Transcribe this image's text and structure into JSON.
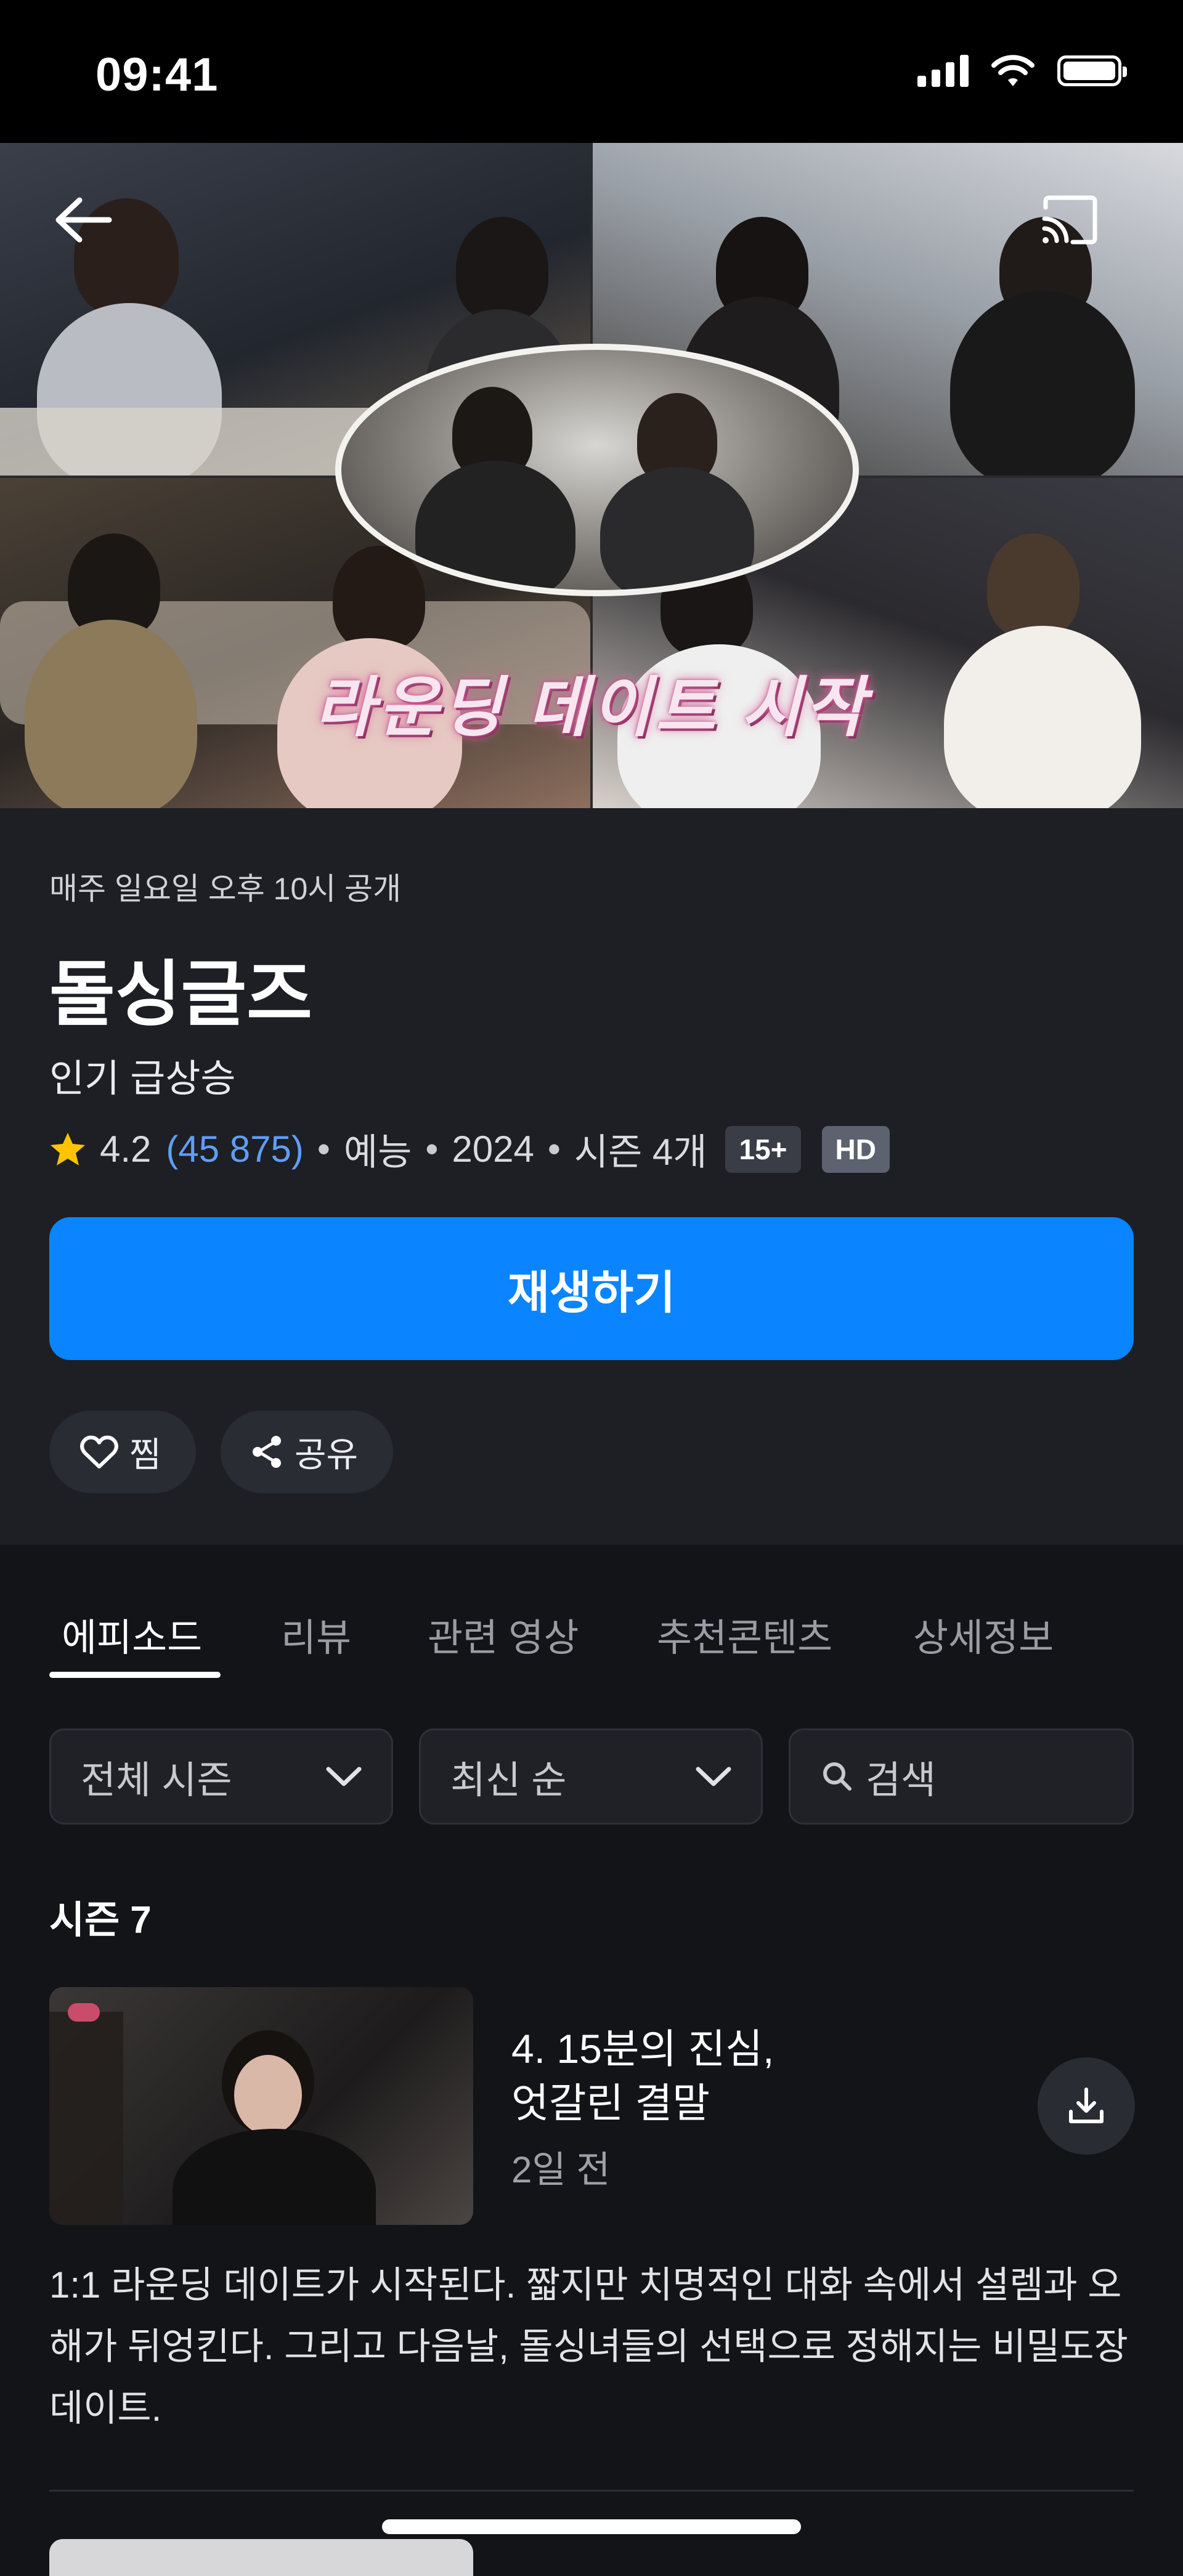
{
  "status_bar": {
    "time": "09:41"
  },
  "hero": {
    "overlay_text": "라운딩 데이트 시작",
    "back_icon": "back-arrow-icon",
    "cast_icon": "cast-icon"
  },
  "show": {
    "schedule": "매주 일요일 오후 10시 공개",
    "title": "돌싱글즈",
    "trend": "인기 급상승",
    "rating": "4.2",
    "rating_count": "(45 875)",
    "genre": "예능",
    "year": "2024",
    "seasons": "시즌 4개",
    "age_badge": "15+",
    "quality_badge": "HD"
  },
  "actions": {
    "play_label": "재생하기",
    "like_label": "찜",
    "share_label": "공유"
  },
  "tabs": [
    {
      "label": "에피소드",
      "active": true
    },
    {
      "label": "리뷰",
      "active": false
    },
    {
      "label": "관련 영상",
      "active": false
    },
    {
      "label": "추천콘텐츠",
      "active": false
    },
    {
      "label": "상세정보",
      "active": false
    }
  ],
  "filters": {
    "season_select": "전체 시즌",
    "sort_select": "최신 순",
    "search_placeholder": "검색"
  },
  "season_heading": "시즌 7",
  "episodes": [
    {
      "title_line1": "4. 15분의 진심,",
      "title_line2": "엇갈린 결말",
      "date": "2일 전",
      "description": "1:1 라운딩 데이트가 시작된다. 짧지만 치명적인 대화 속에서 설렘과 오해가 뒤엉킨다. 그리고 다음날, 돌싱녀들의 선택으로 정해지는 비밀도장 데이트."
    }
  ],
  "colors": {
    "accent": "#0A84FF",
    "rating_count": "#5F9EF7",
    "star": "#FFC400",
    "background": "#131418",
    "info_panel": "#1D1F24"
  }
}
